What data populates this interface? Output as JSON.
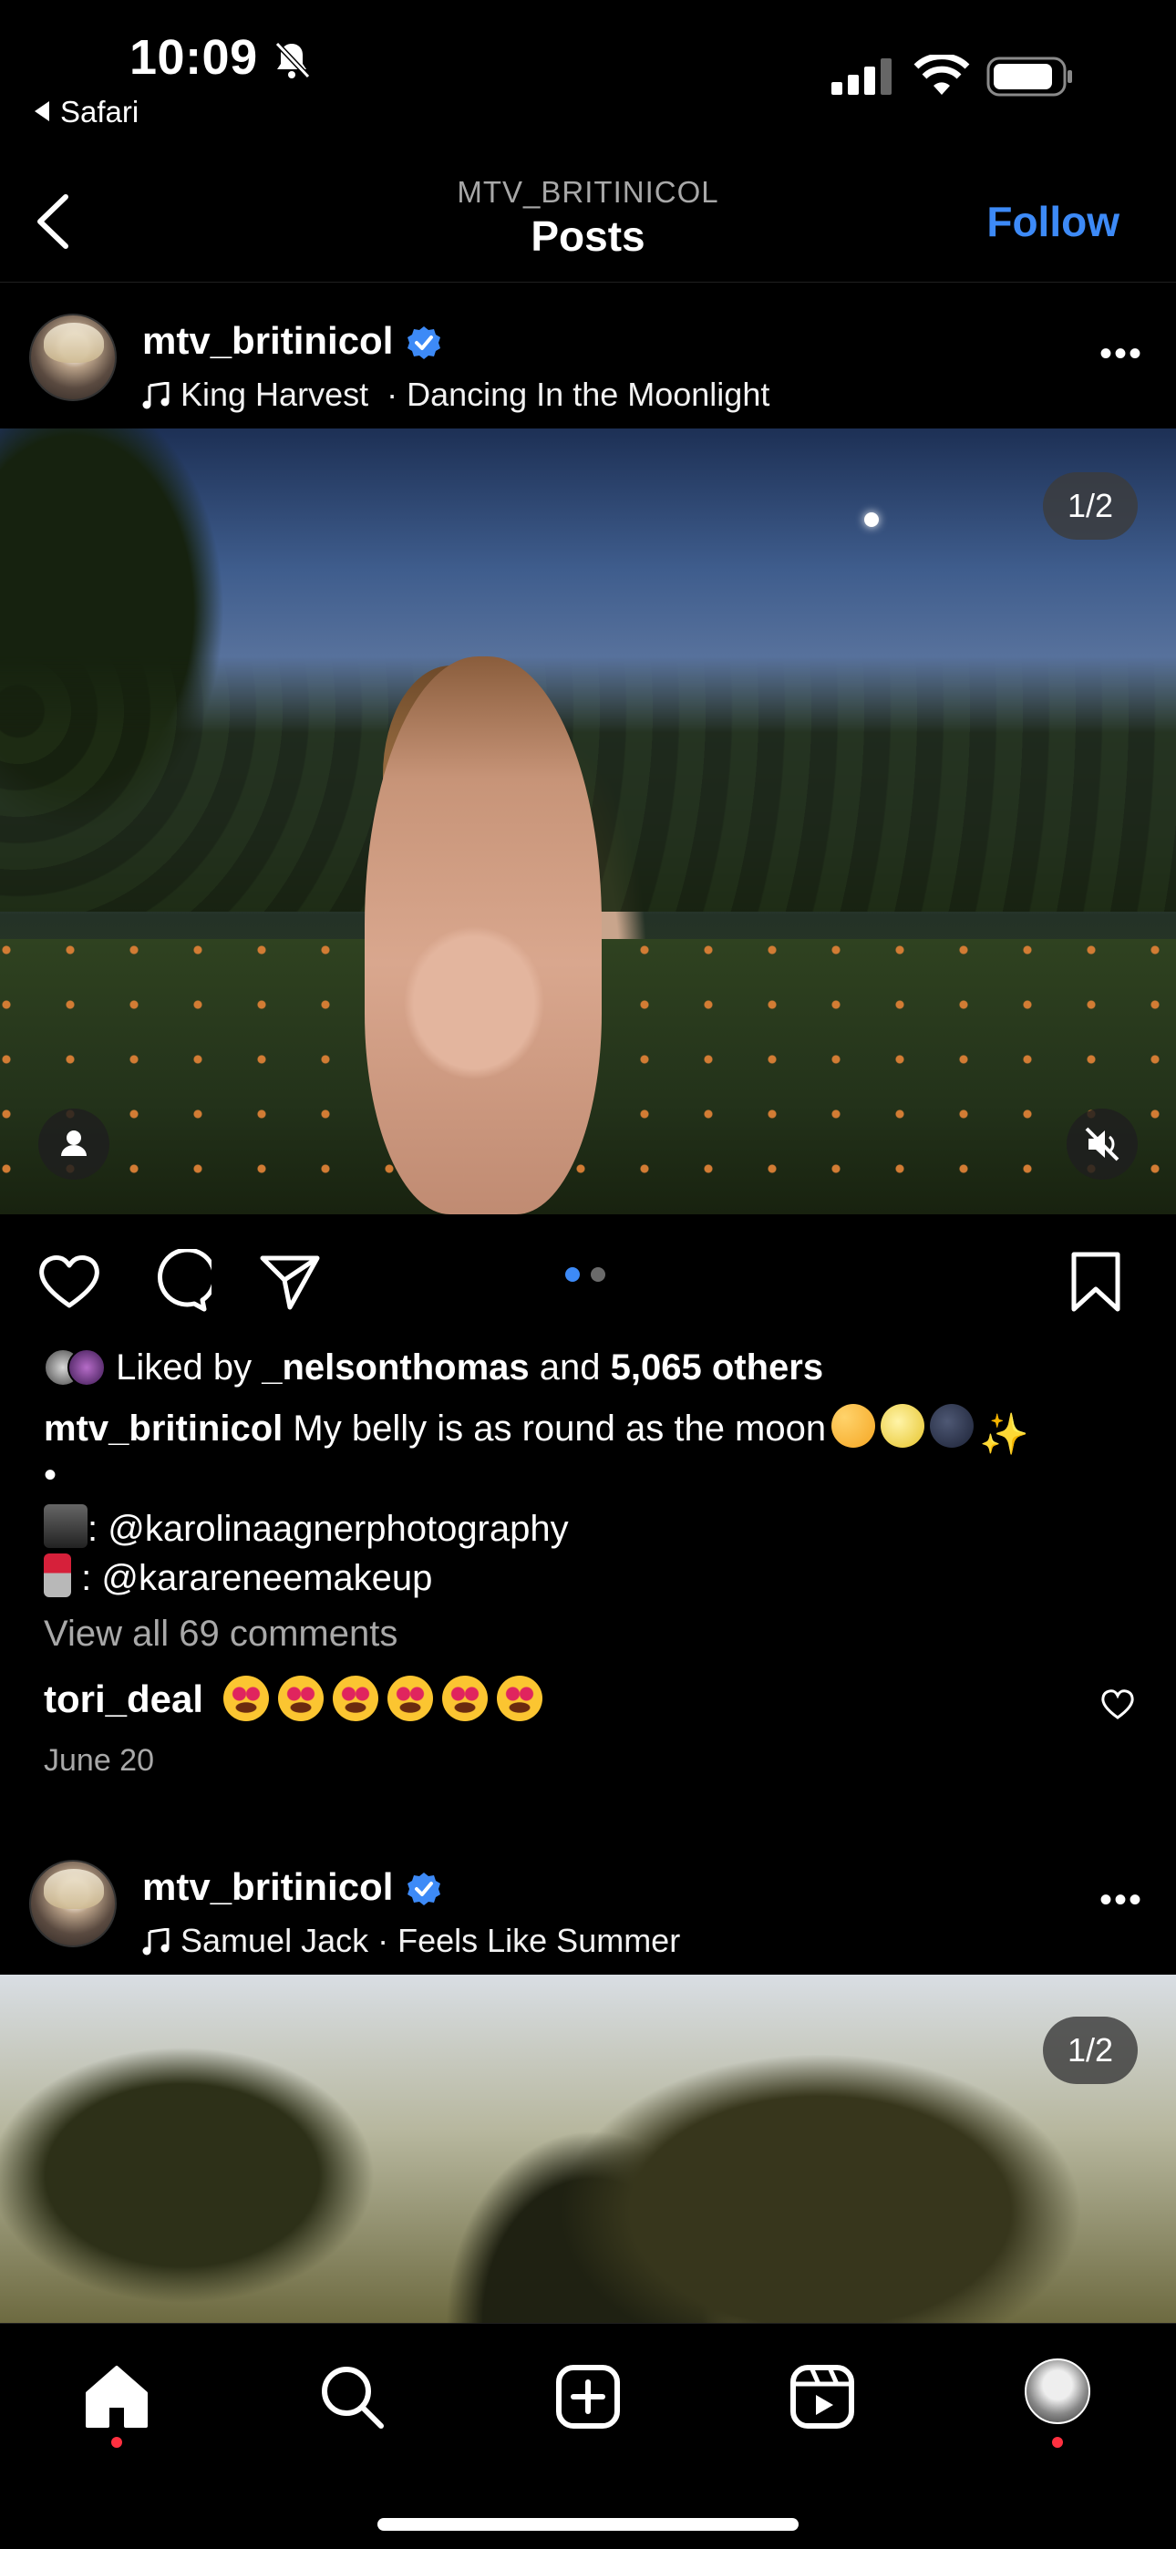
{
  "status_bar": {
    "time": "10:09",
    "back_app": "Safari"
  },
  "header": {
    "username": "MTV_BRITINICOL",
    "title": "Posts",
    "follow_label": "Follow"
  },
  "posts": [
    {
      "handle": "mtv_britinicol",
      "artist": "King Harvest",
      "song": "· Dancing In the Moonlight",
      "counter": "1/2",
      "liked_by_prefix": "Liked by",
      "liked_by_user": "_nelsonthomas",
      "liked_by_and": "and",
      "liked_by_others": "5,065 others",
      "caption_text": "My belly is as round as the moon",
      "caption_bullet": "•",
      "credit_photo": ": @karolinaagnerphotography",
      "credit_makeup": " : @karareneemakeup",
      "view_comments": "View all 69 comments",
      "top_comment_user": "tori_deal",
      "date": "June 20"
    },
    {
      "handle": "mtv_britinicol",
      "artist": "Samuel Jack",
      "song": "· Feels Like Summer",
      "counter": "1/2"
    }
  ],
  "colors": {
    "accent": "#3d8af7",
    "notification": "#ff3040",
    "muted_text": "#a8a8a8"
  },
  "icons": {
    "tabs": [
      "home-icon",
      "search-icon",
      "create-icon",
      "reels-icon",
      "profile-avatar"
    ],
    "actions": [
      "heart-icon",
      "comment-icon",
      "share-icon",
      "bookmark-icon"
    ]
  },
  "carousel": {
    "current": 1,
    "total": 2
  }
}
